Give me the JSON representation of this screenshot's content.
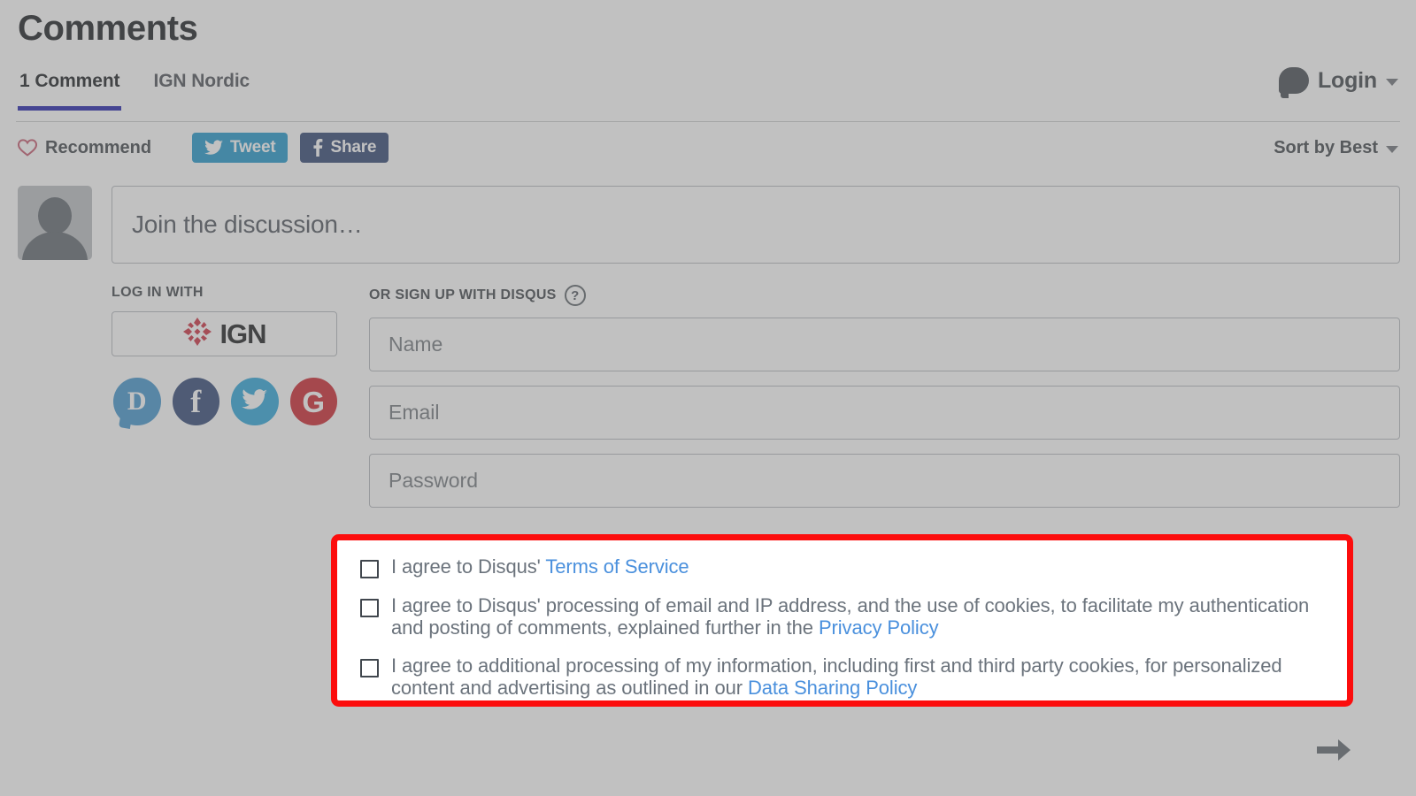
{
  "header": {
    "title": "Comments",
    "tabs": [
      {
        "label": "1 Comment",
        "active": true
      },
      {
        "label": "IGN Nordic",
        "active": false
      }
    ],
    "login_label": "Login",
    "login_icon": "speech-bubble-icon",
    "login_caret_icon": "chevron-down-icon"
  },
  "actions": {
    "recommend_label": "Recommend",
    "recommend_icon": "heart-icon",
    "tweet_label": "Tweet",
    "tweet_icon": "twitter-bird-icon",
    "share_label": "Share",
    "share_icon": "facebook-f-icon",
    "sort_label": "Sort by Best",
    "sort_caret_icon": "chevron-down-icon"
  },
  "composer": {
    "avatar_icon": "default-user-avatar-icon",
    "placeholder": "Join the discussion…"
  },
  "auth": {
    "login_with_label": "LOG IN WITH",
    "ign_button_label": "IGN",
    "ign_logo_icon": "ign-diamond-logo-icon",
    "social_buttons": [
      {
        "name": "disqus",
        "glyph": "D",
        "color": "#3e92cb"
      },
      {
        "name": "facebook",
        "glyph": "f",
        "color": "#2d4373"
      },
      {
        "name": "twitter",
        "glyph": "",
        "color": "#27a3d8"
      },
      {
        "name": "google",
        "glyph": "G",
        "color": "#cc2029"
      }
    ],
    "signup_label": "OR SIGN UP WITH DISQUS",
    "help_glyph": "?",
    "fields": [
      {
        "name": "name",
        "placeholder": "Name",
        "value": ""
      },
      {
        "name": "email",
        "placeholder": "Email",
        "value": ""
      },
      {
        "name": "password",
        "placeholder": "Password",
        "value": ""
      }
    ]
  },
  "consent": {
    "highlight_color": "#fc0d0d",
    "link_color": "#4a90dd",
    "items": [
      {
        "checked": false,
        "text_before": "I agree to Disqus' ",
        "link": "Terms of Service",
        "text_after": ""
      },
      {
        "checked": false,
        "text_before": "I agree to Disqus' processing of email and IP address, and the use of cookies, to facilitate my authentication and posting of comments, explained further in the ",
        "link": "Privacy Policy",
        "text_after": ""
      },
      {
        "checked": false,
        "text_before": "I agree to additional processing of my information, including first and third party cookies, for personalized content and advertising as outlined in our ",
        "link": "Data Sharing Policy",
        "text_after": ""
      }
    ]
  },
  "submit": {
    "icon": "arrow-right-icon"
  }
}
